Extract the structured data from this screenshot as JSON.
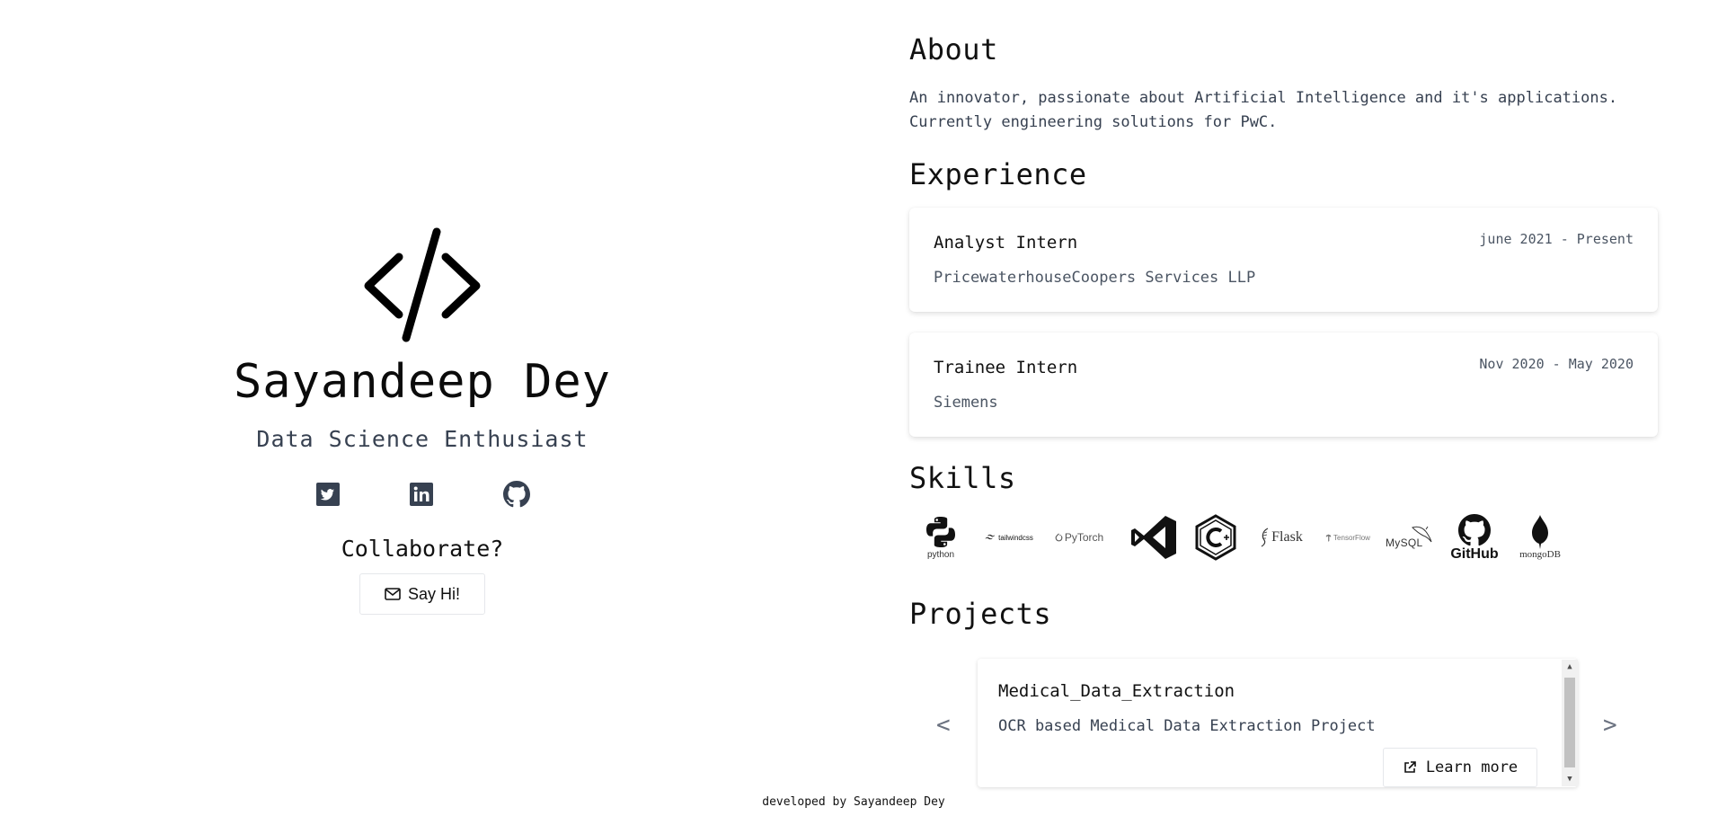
{
  "profile": {
    "name": "Sayandeep Dey",
    "tagline": "Data Science Enthusiast",
    "collaborate": "Collaborate?",
    "say_hi": "Say Hi!"
  },
  "social": [
    {
      "icon": "twitter-icon"
    },
    {
      "icon": "linkedin-icon"
    },
    {
      "icon": "github-icon"
    }
  ],
  "about": {
    "heading": "About",
    "line1": "An innovator, passionate about Artificial Intelligence and it's applications.",
    "line2": "Currently engineering solutions for PwC."
  },
  "experience": {
    "heading": "Experience",
    "items": [
      {
        "role": "Analyst Intern",
        "dates": "june 2021 - Present",
        "org": "PricewaterhouseCoopers Services LLP"
      },
      {
        "role": "Trainee Intern",
        "dates": "Nov 2020 - May 2020",
        "org": "Siemens"
      }
    ]
  },
  "skills": {
    "heading": "Skills",
    "items": [
      {
        "icon": "python-logo-icon",
        "label": "python"
      },
      {
        "icon": "tailwindcss-logo-icon",
        "label": "tailwindcss"
      },
      {
        "icon": "pytorch-logo-icon",
        "label": "PyTorch"
      },
      {
        "icon": "vscode-logo-icon",
        "label": ""
      },
      {
        "icon": "cplusplus-logo-icon",
        "label": ""
      },
      {
        "icon": "flask-logo-icon",
        "label": "Flask"
      },
      {
        "icon": "tensorflow-logo-icon",
        "label": "TensorFlow"
      },
      {
        "icon": "mysql-logo-icon",
        "label": "MySQL"
      },
      {
        "icon": "github-logo-icon",
        "label": "GitHub"
      },
      {
        "icon": "mongodb-logo-icon",
        "label": "mongoDB"
      }
    ]
  },
  "projects": {
    "heading": "Projects",
    "prev": "<",
    "next": ">",
    "items": [
      {
        "title": "Medical_Data_Extraction",
        "desc": "OCR based Medical Data Extraction Project",
        "cta": "Learn more"
      }
    ]
  },
  "footer": "developed by Sayandeep Dey",
  "colors": {
    "text": "#111827",
    "muted": "#4b5563",
    "icon": "#374151"
  }
}
